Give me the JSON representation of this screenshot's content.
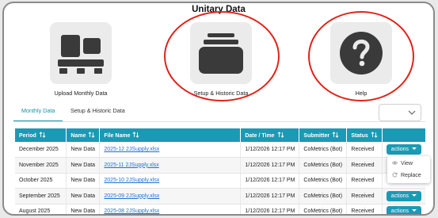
{
  "page": {
    "title": "Unitary Data"
  },
  "tiles": [
    {
      "label": "Upload Monthly Data",
      "icon": "upload-data-icon"
    },
    {
      "label": "Setup & Historic Data",
      "icon": "archive-box-icon"
    },
    {
      "label": "Help",
      "icon": "question-mark-icon"
    }
  ],
  "tabs": [
    {
      "label": "Monthly Data",
      "active": true
    },
    {
      "label": "Setup & Historic Data",
      "active": false
    }
  ],
  "filter": {
    "value": ""
  },
  "table": {
    "columns": [
      "Period",
      "Name",
      "File Name",
      "Date / Time",
      "Submitter",
      "Status",
      ""
    ],
    "rows": [
      {
        "period": "December 2025",
        "name": "New Data",
        "file": "2025-12 2JSupply.xlsx",
        "datetime": "1/12/2026 12:17 PM",
        "submitter": "CoMetrics (Bot)",
        "status": "Received",
        "action": "actions"
      },
      {
        "period": "November 2025",
        "name": "New Data",
        "file": "2025-11 2JSupply.xlsx",
        "datetime": "1/12/2026 12:17 PM",
        "submitter": "CoMetrics (Bot)",
        "status": "Received",
        "action": ""
      },
      {
        "period": "October 2025",
        "name": "New Data",
        "file": "2025-10 2JSupply.xlsx",
        "datetime": "1/12/2026 12:17 PM",
        "submitter": "CoMetrics (Bot)",
        "status": "Received",
        "action": ""
      },
      {
        "period": "September 2025",
        "name": "New Data",
        "file": "2025-09 2JSupply.xlsx",
        "datetime": "1/12/2026 12:17 PM",
        "submitter": "CoMetrics (Bot)",
        "status": "Received",
        "action": "actions"
      },
      {
        "period": "August 2025",
        "name": "New Data",
        "file": "2025-08 2JSupply.xlsx",
        "datetime": "1/12/2026 12:17 PM",
        "submitter": "CoMetrics (Bot)",
        "status": "Received",
        "action": "actions"
      }
    ]
  },
  "actions_menu": {
    "items": [
      {
        "label": "View",
        "icon": "eye-icon"
      },
      {
        "label": "Replace",
        "icon": "refresh-icon"
      }
    ]
  },
  "colors": {
    "accent": "#1b9ab3",
    "link": "#1f6fd6",
    "annotation": "#e0231a",
    "icon": "#3a3a3a"
  }
}
